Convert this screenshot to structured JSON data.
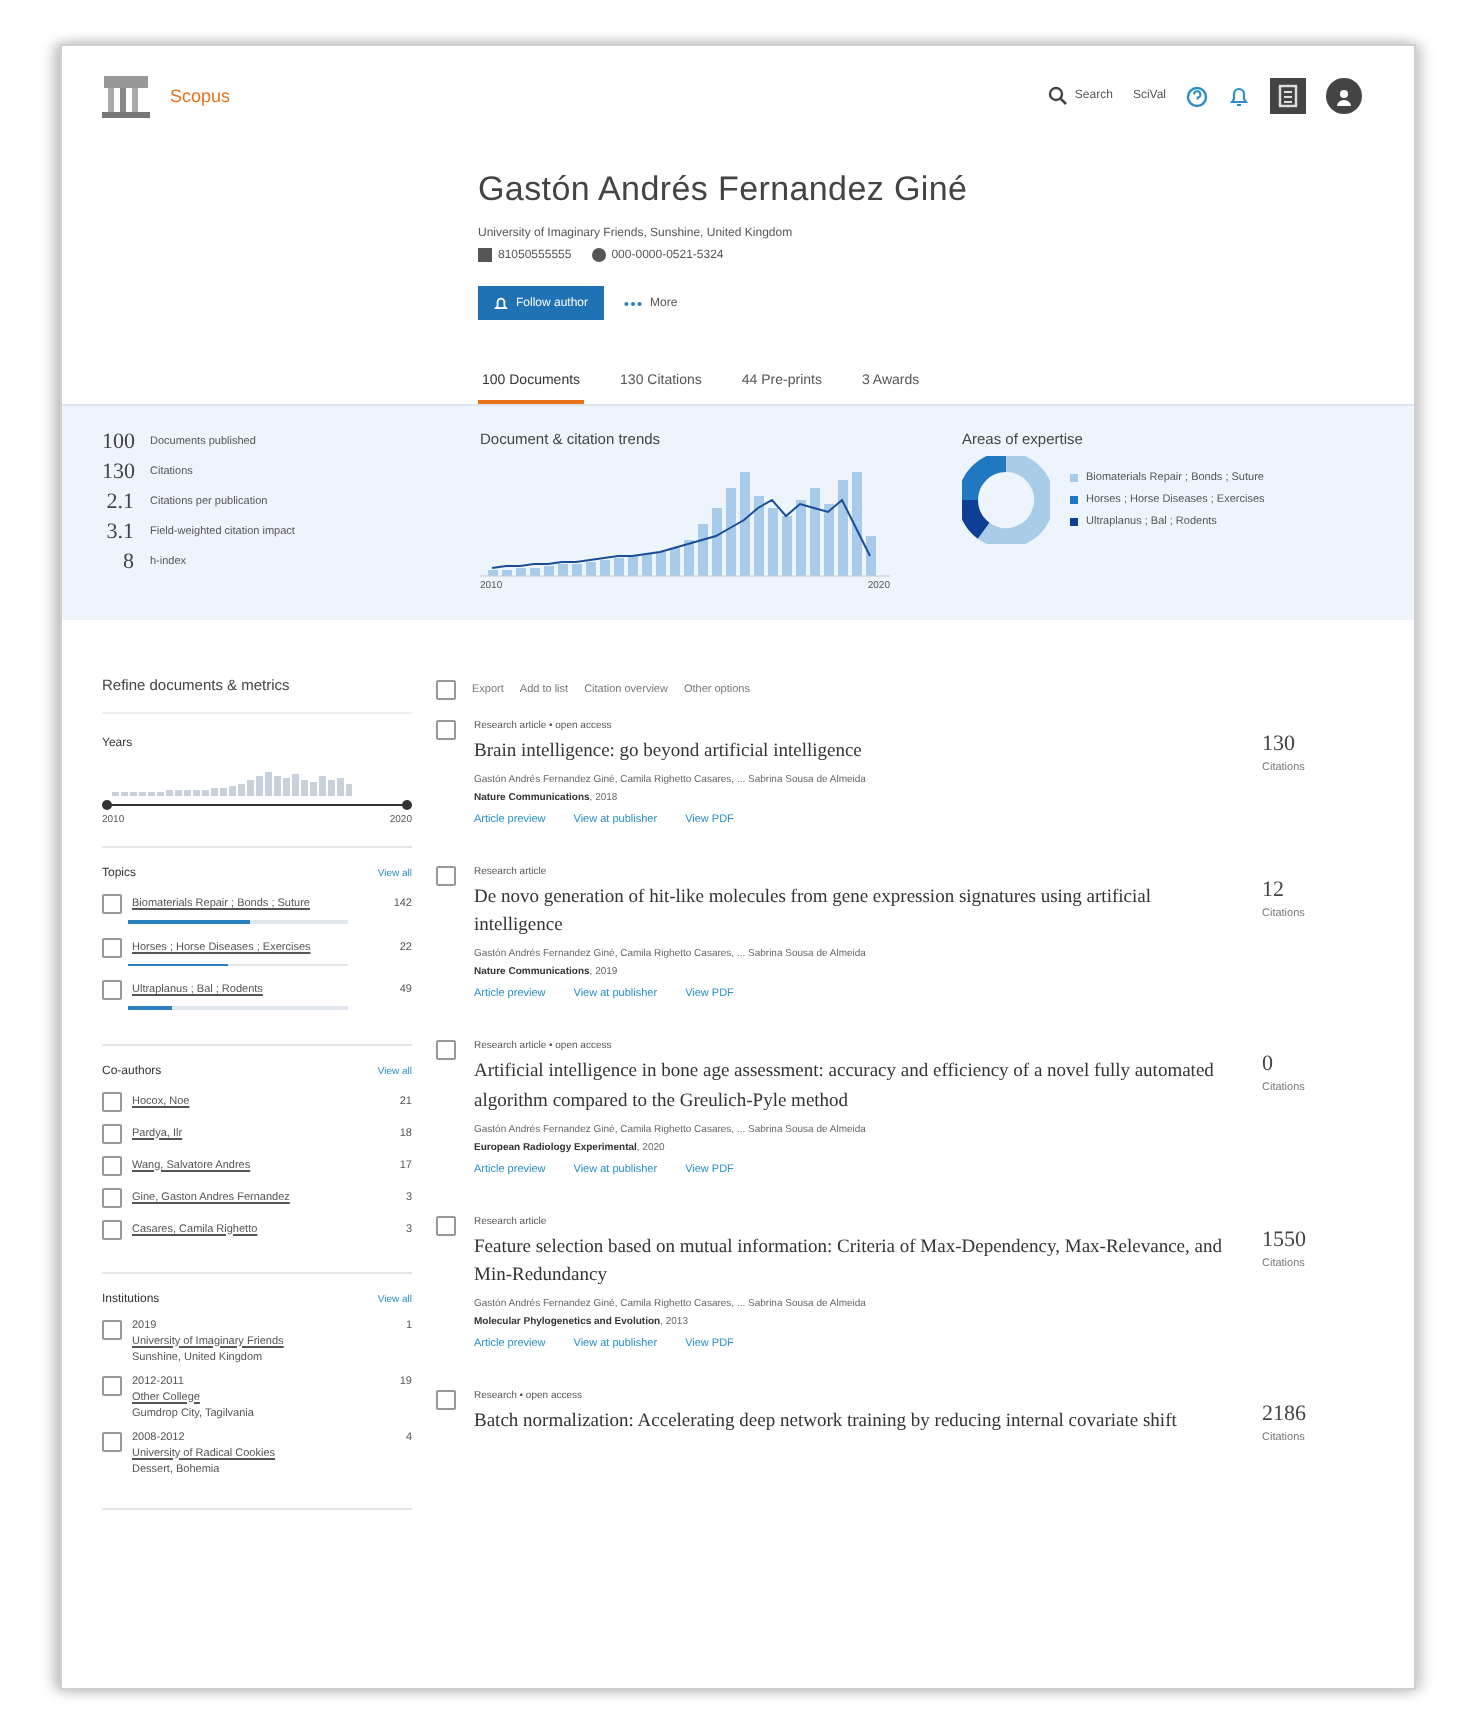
{
  "header": {
    "brand": "Scopus",
    "links": [
      "Search",
      "SciVal"
    ]
  },
  "profile": {
    "name": "Gastón Andrés Fernandez Giné",
    "affiliation": "University of Imaginary Friends, Sunshine, United Kingdom",
    "author_id": "81050555555",
    "orcid": "000-0000-0521-5324",
    "follow_button": "Follow author",
    "more_button": "More"
  },
  "tabs": [
    {
      "label": "100 Documents",
      "selected": true
    },
    {
      "label": "130 Citations",
      "selected": false
    },
    {
      "label": "44 Pre-prints",
      "selected": false
    },
    {
      "label": "3 Awards",
      "selected": false
    }
  ],
  "metrics": {
    "stats": [
      {
        "value": "100",
        "label": "Documents published"
      },
      {
        "value": "130",
        "label": "Citations"
      },
      {
        "value": "2.1",
        "label": "Citations per publication"
      },
      {
        "value": "3.1",
        "label": "Field-weighted citation impact"
      },
      {
        "value": "8",
        "label": "h-index"
      }
    ],
    "trends": {
      "title": "Document & citation trends",
      "start": "2010",
      "end": "2020"
    },
    "expertise": {
      "title": "Areas of expertise",
      "areas": [
        {
          "label": "Biomaterials Repair ; Bonds ; Suture",
          "color": "#a9cde8"
        },
        {
          "label": "Horses ; Horse Diseases ; Exercises",
          "color": "#1f78c1"
        },
        {
          "label": "Ultraplanus ; Bal ; Rodents",
          "color": "#0d3f94"
        }
      ]
    }
  },
  "sidebar": {
    "title": "Refine documents & metrics",
    "years": {
      "title": "Years",
      "start": "2010",
      "end": "2020",
      "level": 1
    },
    "topics": {
      "title": "Topics",
      "view_all": "View all",
      "items": [
        {
          "label": "Biomaterials Repair ; Bonds ; Suture",
          "count": "142",
          "level": 0.55,
          "checked": false
        },
        {
          "label": "Horses ; Horse Diseases ; Exercises",
          "count": "22",
          "level": 0.45,
          "checked": false
        },
        {
          "label": "Ultraplanus ; Bal ; Rodents",
          "count": "49",
          "level": 0.2,
          "checked": false
        }
      ]
    },
    "coauthors": {
      "title": "Co-authors",
      "view_all": "View all",
      "items": [
        {
          "label": "Hocox, Noe",
          "count": "21",
          "checked": false
        },
        {
          "label": "Pardya, Ilr",
          "count": "18",
          "checked": false
        },
        {
          "label": "Wang, Salvatore Andres",
          "count": "17",
          "checked": false
        },
        {
          "label": "Gine, Gaston Andres Fernandez",
          "count": "3",
          "checked": false
        },
        {
          "label": "Casares, Camila Righetto",
          "count": "3",
          "checked": false
        }
      ]
    },
    "institutions": {
      "title": "Institutions",
      "view_all": "View all",
      "items": [
        {
          "years": "2019",
          "count": "1",
          "name": "University of Imaginary Friends",
          "place": "Sunshine, United Kingdom",
          "checked": false
        },
        {
          "years": "2012-2011",
          "count": "19",
          "name": "Other College",
          "place": "Gumdrop City, Tagilvania",
          "checked": false
        },
        {
          "years": "2008-2012",
          "count": "4",
          "name": "University of Radical Cookies",
          "place": "Dessert, Bohemia",
          "checked": false
        }
      ]
    }
  },
  "toolbar": {
    "checked": false,
    "actions": [
      "Export",
      "Add to list",
      "Citation overview",
      "Other options"
    ]
  },
  "documents": [
    {
      "type": "Research article • open access",
      "title": "Brain intelligence: go beyond artificial intelligence",
      "authors": "Gastón Andrés Fernandez Giné, Camila Righetto Casares, ... Sabrina Sousa de Almeida",
      "source": "**Nature Communications**, 2018",
      "links": [
        "Article preview",
        "View at publisher",
        "View PDF"
      ],
      "citations": "130",
      "citations_label": "Citations",
      "checked": false
    },
    {
      "type": "Research article",
      "title": "De novo generation of hit-like molecules from gene expression signatures using artificial intelligence",
      "authors": "Gastón Andrés Fernandez Giné, Camila Righetto Casares, ... Sabrina Sousa de Almeida",
      "source": "**Nature Communications**, 2019",
      "links": [
        "Article preview",
        "View at publisher",
        "View PDF"
      ],
      "citations": "12",
      "citations_label": "Citations",
      "checked": false
    },
    {
      "type": "Research article • open access",
      "title": "Artificial intelligence in bone age assessment: accuracy and efficiency of a novel fully automated algorithm compared to the Greulich-Pyle method",
      "authors": "Gastón Andrés Fernandez Giné, Camila Righetto Casares, ... Sabrina Sousa de Almeida",
      "source": "**European Radiology Experimental**, 2020",
      "links": [
        "Article preview",
        "View at publisher",
        "View PDF"
      ],
      "citations": "0",
      "citations_label": "Citations",
      "checked": false
    },
    {
      "type": "Research article",
      "title": "Feature selection based on mutual information: Criteria of Max-Dependency, Max-Relevance, and Min-Redundancy",
      "authors": "Gastón Andrés Fernandez Giné, Camila Righetto Casares, ... Sabrina Sousa de Almeida",
      "source": "**Molecular Phylogenetics and Evolution**, 2013",
      "links": [
        "Article preview",
        "View at publisher",
        "View PDF"
      ],
      "citations": "1550",
      "citations_label": "Citations",
      "checked": false
    },
    {
      "type": "Research • open access",
      "title": "Batch normalization: Accelerating deep network training by reducing internal covariate shift",
      "citations": "2186",
      "citations_label": "Citations",
      "checked": false
    }
  ]
}
